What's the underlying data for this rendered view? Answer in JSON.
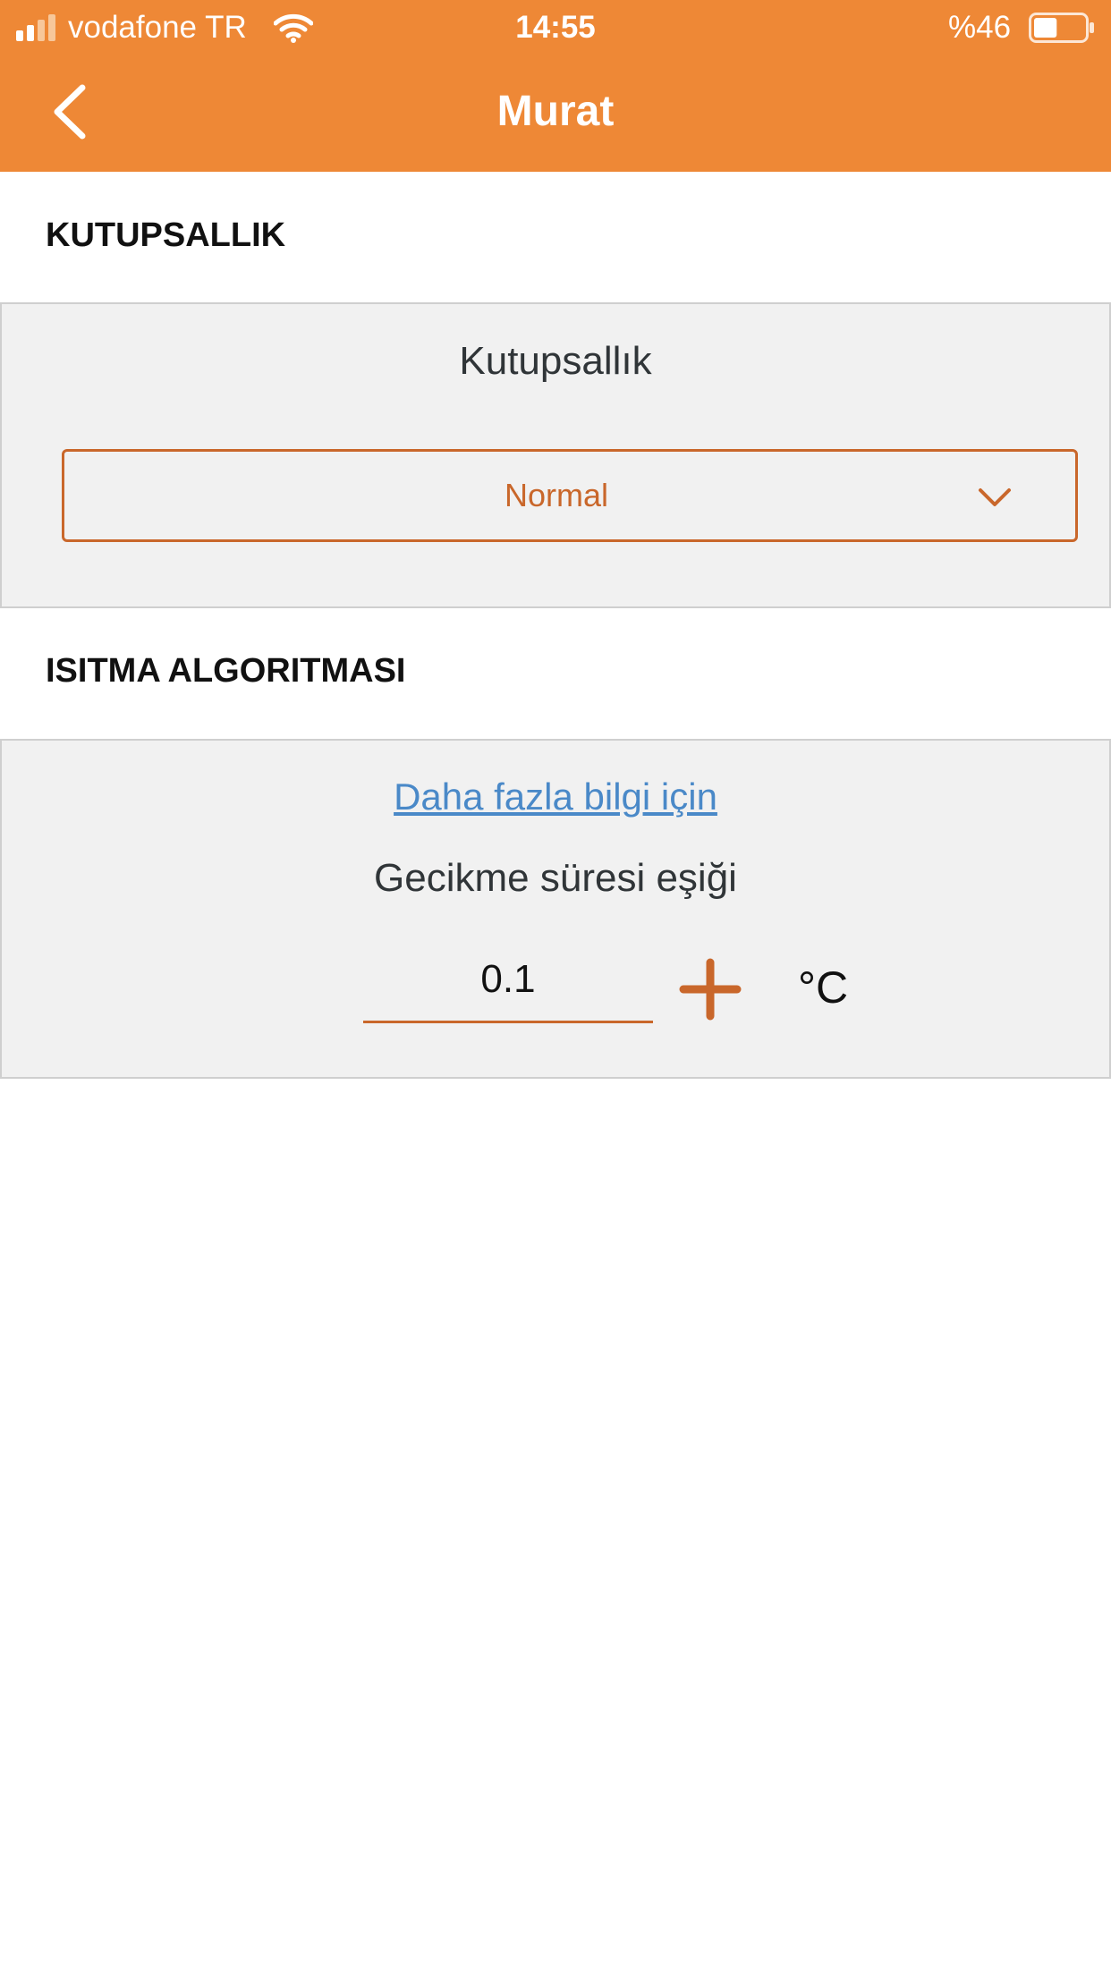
{
  "status_bar": {
    "carrier": "vodafone TR",
    "time": "14:55",
    "battery_percent": "%46",
    "battery_level": 0.46
  },
  "header": {
    "title": "Murat",
    "back_icon": "chevron-left-icon"
  },
  "colors": {
    "header_bg": "#ee8836",
    "accent": "#c9672b",
    "link": "#4a89c8",
    "panel_bg": "#f1f1f1"
  },
  "polarity": {
    "section_heading": "KUTUPSALLIK",
    "label": "Kutupsallık",
    "selected": "Normal",
    "dropdown_icon": "chevron-down-icon"
  },
  "heating": {
    "section_heading": "ISITMA ALGORITMASI",
    "info_link": "Daha fazla bilgi için",
    "threshold_label": "Gecikme süresi eşiği",
    "threshold_value": "0.1",
    "unit": "°C",
    "increment_icon": "plus-icon"
  }
}
